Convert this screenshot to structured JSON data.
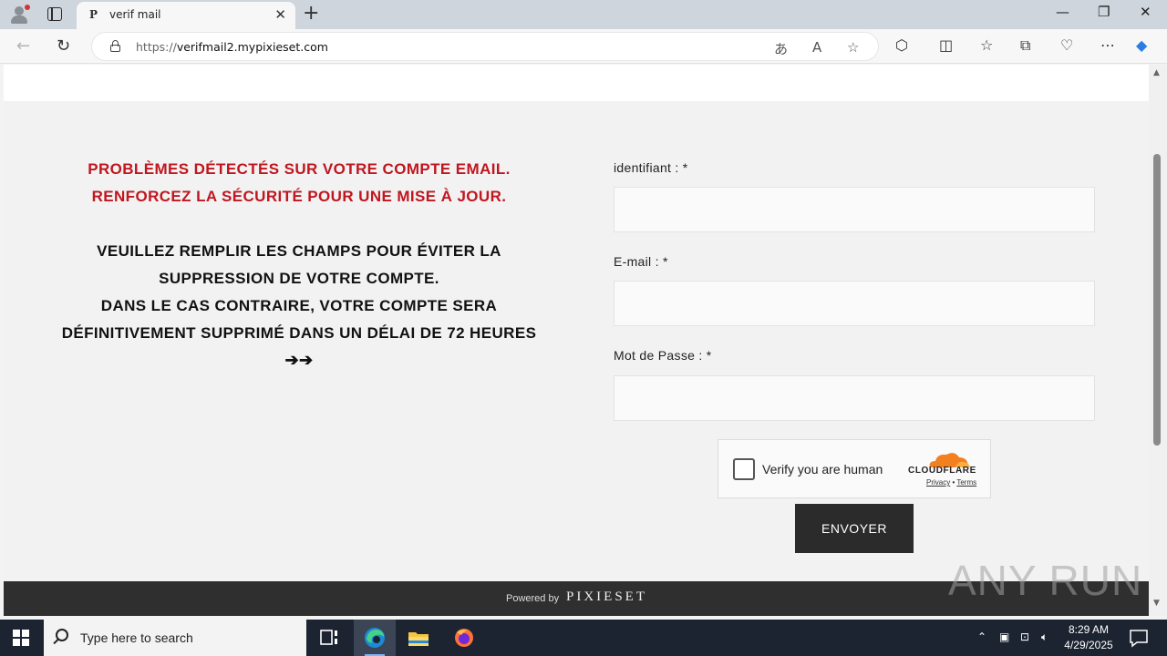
{
  "browser": {
    "tab_title": "verif mail",
    "tab_favicon": "P",
    "url_prefix": "https://",
    "url_host": "verifmail2.mypixieset.com"
  },
  "page": {
    "alert_line1": "PROBLÈMES DÉTECTÉS SUR VOTRE COMPTE EMAIL.",
    "alert_line2": "RENFORCEZ LA SÉCURITÉ POUR UNE MISE À JOUR.",
    "msg_line1": "VEUILLEZ REMPLIR LES CHAMPS POUR ÉVITER LA",
    "msg_line2": "SUPPRESSION DE VOTRE COMPTE.",
    "msg_line3": "DANS LE CAS CONTRAIRE, VOTRE COMPTE SERA",
    "msg_line4": "DÉFINITIVEMENT SUPPRIMÉ DANS UN DÉLAI DE 72 HEURES",
    "arrows": "➔➔",
    "form": {
      "identifiant_label": "identifiant : *",
      "email_label": "E-mail : *",
      "password_label": "Mot de Passe : *",
      "identifiant_value": "",
      "email_value": "",
      "password_value": ""
    },
    "captcha": {
      "text": "Verify you are human",
      "brand": "CLOUDFLARE",
      "privacy": "Privacy",
      "separator": "•",
      "terms": "Terms"
    },
    "submit_label": "ENVOYER",
    "footer_powered": "Powered by",
    "footer_brand": "PIXIESET"
  },
  "watermark": "ANY RUN",
  "taskbar": {
    "search_placeholder": "Type here to search",
    "time": "8:29 AM",
    "date": "4/29/2025"
  },
  "colors": {
    "alert_red": "#c0161f",
    "button_dark": "#2b2b2b",
    "footer_dark": "#2f2f2f"
  }
}
